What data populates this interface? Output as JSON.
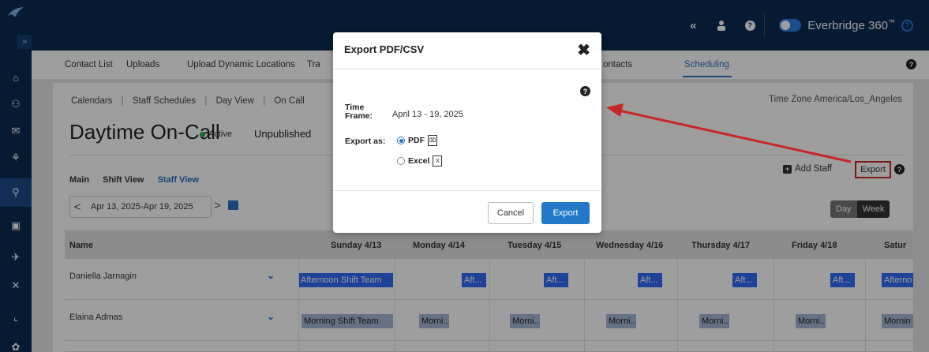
{
  "topbar": {
    "collapse_glyph": "«",
    "user_icon": "user-icon",
    "help_glyph": "?",
    "brand": "Everbridge 360",
    "brand_tm": "™"
  },
  "sidebar": {
    "collapse_glyph": "»",
    "items": [
      {
        "icon": "home-icon",
        "glyph": "⌂"
      },
      {
        "icon": "people-icon",
        "glyph": "⚇"
      },
      {
        "icon": "megaphone-icon",
        "glyph": "✉"
      },
      {
        "icon": "scheduling-icon",
        "glyph": "⚘"
      },
      {
        "icon": "location-icon",
        "glyph": "⚲"
      },
      {
        "icon": "calendar-icon",
        "glyph": "▣"
      },
      {
        "icon": "plane-icon",
        "glyph": "✈"
      },
      {
        "icon": "incident-icon",
        "glyph": "✕"
      },
      {
        "icon": "chart-icon",
        "glyph": "⌞"
      },
      {
        "icon": "settings-icon",
        "glyph": "✿"
      }
    ]
  },
  "nav": {
    "tabs": [
      "Contact List",
      "Uploads",
      "Upload Dynamic Locations",
      "Tra",
      "ontacts",
      "Scheduling"
    ],
    "help_glyph": "?"
  },
  "breadcrumb": {
    "items": [
      "Calendars",
      "Staff Schedules",
      "Day View",
      "On Call"
    ],
    "separator": "|"
  },
  "timezone": "Time Zone America/Los_Angeles",
  "page": {
    "title": "Daytime On-Call",
    "status": "Active",
    "state": "Unpublished"
  },
  "view_tabs": [
    "Main",
    "Shift View",
    "Staff View"
  ],
  "actions": {
    "add_staff": "Add Staff",
    "export": "Export"
  },
  "date_range": {
    "label": "Apr 13, 2025-Apr 19, 2025",
    "prev": "<",
    "next": ">"
  },
  "segmented": {
    "day": "Day",
    "week": "Week"
  },
  "table": {
    "headers": [
      "Name",
      "Sunday 4/13",
      "Monday 4/14",
      "Tuesday 4/15",
      "Wednesday 4/16",
      "Thursday 4/17",
      "Friday 4/18",
      "Satur"
    ],
    "rows": [
      {
        "name": "Daniella Jarnagin",
        "cells": [
          "Afternoon Shift Team",
          "Aft...",
          "Aft...",
          "Aft...",
          "Aft...",
          "Aft...",
          "Afterno"
        ],
        "kind": "aft"
      },
      {
        "name": "Elaina Admas",
        "cells": [
          "Morning Shift Team",
          "Morni...",
          "Morni...",
          "Morni...",
          "Morni...",
          "Morni...",
          "Mornin"
        ],
        "kind": "morn"
      }
    ]
  },
  "modal": {
    "title": "Export PDF/CSV",
    "close_glyph": "✖",
    "help_glyph": "?",
    "time_frame_label_1": "Time",
    "time_frame_label_2": "Frame:",
    "time_frame_value": "April 13 - 19, 2025",
    "export_as_label": "Export as:",
    "options": [
      "PDF",
      "Excel"
    ],
    "selected": "PDF",
    "cancel": "Cancel",
    "export": "Export"
  },
  "colors": {
    "topbar": "#0b2a52",
    "accent": "#2d6fc2",
    "afternoon": "#2f6bf5",
    "morning": "#a5b7d3",
    "annotation": "#c62828"
  }
}
